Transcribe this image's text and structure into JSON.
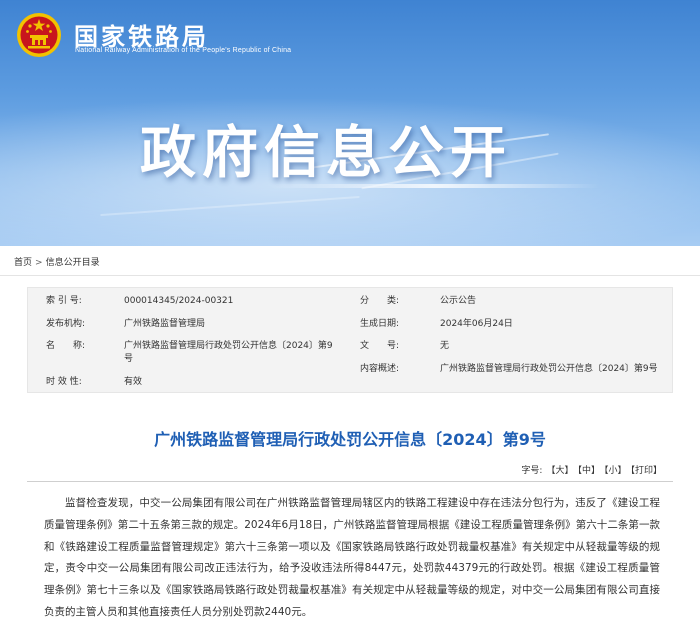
{
  "header": {
    "org_name_cn": "国家铁路局",
    "org_name_en": "National Railway Administration of the People's Republic of China",
    "slogan": "政府信息公开"
  },
  "breadcrumb": {
    "home": "首页",
    "separator": ">",
    "current": "信息公开目录"
  },
  "info_table": {
    "index_label": "索 引 号:",
    "index_value": "000014345/2024-00321",
    "category_label": "分　　类:",
    "category_value": "公示公告",
    "issuer_label": "发布机构:",
    "issuer_value": "广州铁路监督管理局",
    "date_label": "生成日期:",
    "date_value": "2024年06月24日",
    "name_label": "名　　称:",
    "name_value": "广州铁路监督管理局行政处罚公开信息〔2024〕第9号",
    "doc_no_label": "文　　号:",
    "doc_no_value": "无",
    "summary_label": "内容概述:",
    "summary_value": "广州铁路监督管理局行政处罚公开信息〔2024〕第9号",
    "validity_label": "时 效 性:",
    "validity_value": "有效"
  },
  "article": {
    "title": "广州铁路监督管理局行政处罚公开信息〔2024〕第9号",
    "font_label": "字号:",
    "font_large": "【大】",
    "font_medium": "【中】",
    "font_small": "【小】",
    "print": "【打印】",
    "body": "监督检查发现，中交一公局集团有限公司在广州铁路监督管理局辖区内的铁路工程建设中存在违法分包行为，违反了《建设工程质量管理条例》第二十五条第三款的规定。2024年6月18日，广州铁路监督管理局根据《建设工程质量管理条例》第六十二条第一款和《铁路建设工程质量监督管理规定》第六十三条第一项以及《国家铁路局铁路行政处罚裁量权基准》有关规定中从轻裁量等级的规定，责令中交一公局集团有限公司改正违法行为，给予没收违法所得8447元，处罚款44379元的行政处罚。根据《建设工程质量管理条例》第七十三条以及《国家铁路局铁路行政处罚裁量权基准》有关规定中从轻裁量等级的规定，对中交一公局集团有限公司直接负责的主管人员和其他直接责任人员分别处罚款2440元。"
  },
  "colors": {
    "banner_blue": "#3f83d2",
    "title_blue": "#1f5fb4",
    "emblem_red": "#c8161d",
    "emblem_gold": "#f2c200"
  }
}
